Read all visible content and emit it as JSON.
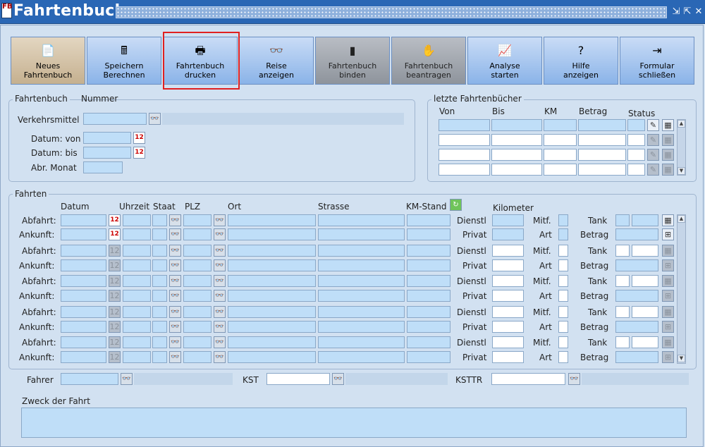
{
  "window": {
    "title": "Fahrtenbuch",
    "app_icon": "fahrtenbuch-app-icon"
  },
  "toolbar": [
    {
      "name": "new-logbook-button",
      "line1": "Neues",
      "line2": "Fahrtenbuch",
      "icon": "new-document-icon",
      "glyph": "📄",
      "state": "selected"
    },
    {
      "name": "save-calculate-button",
      "line1": "Speichern",
      "line2": "Berechnen",
      "icon": "save-calculator-icon",
      "glyph": "🖩",
      "state": "normal"
    },
    {
      "name": "print-logbook-button",
      "line1": "Fahrtenbuch",
      "line2": "drucken",
      "icon": "printer-icon",
      "glyph": "🖶",
      "state": "normal"
    },
    {
      "name": "show-trip-button",
      "line1": "Reise",
      "line2": "anzeigen",
      "icon": "binoculars-icon",
      "glyph": "👓",
      "state": "normal"
    },
    {
      "name": "bind-logbook-button",
      "line1": "Fahrtenbuch",
      "line2": "binden",
      "icon": "binder-icon",
      "glyph": "▮",
      "state": "disabled"
    },
    {
      "name": "request-logbook-button",
      "line1": "Fahrtenbuch",
      "line2": "beantragen",
      "icon": "request-person-icon",
      "glyph": "✋",
      "state": "disabled"
    },
    {
      "name": "start-analysis-button",
      "line1": "Analyse",
      "line2": "starten",
      "icon": "chart-presentation-icon",
      "glyph": "📈",
      "state": "normal"
    },
    {
      "name": "show-help-button",
      "line1": "Hilfe",
      "line2": "anzeigen",
      "icon": "help-icon",
      "glyph": "?",
      "state": "normal"
    },
    {
      "name": "close-form-button",
      "line1": "Formular",
      "line2": "schließen",
      "icon": "exit-door-icon",
      "glyph": "⇥",
      "state": "normal"
    }
  ],
  "logbook": {
    "legend": "Fahrtenbuch",
    "number_label": "Nummer",
    "vehicle_label": "Verkehrsmittel",
    "vehicle_value": "",
    "date_from_label": "Datum: von",
    "date_to_label": "Datum: bis",
    "month_label": "Abr. Monat"
  },
  "recent": {
    "legend": "letzte Fahrtenbücher",
    "columns": [
      "Von",
      "Bis",
      "KM",
      "Betrag",
      "Status"
    ],
    "row_count": 4
  },
  "trips": {
    "legend": "Fahrten",
    "columns": {
      "datum": "Datum",
      "uhrzeit": "Uhrzeit",
      "staat": "Staat",
      "plz": "PLZ",
      "ort": "Ort",
      "strasse": "Strasse",
      "km_stand": "KM-Stand",
      "kilometer": "Kilometer"
    },
    "departure_label": "Abfahrt:",
    "arrival_label": "Ankunft:",
    "dienstl_label": "Dienstl",
    "privat_label": "Privat",
    "mitf_label": "Mitf.",
    "art_label": "Art",
    "tank_label": "Tank",
    "betrag_label": "Betrag",
    "trip_count": 5
  },
  "footer": {
    "driver_label": "Fahrer",
    "kst_label": "KST",
    "ksttr_label": "KSTTR",
    "purpose_label": "Zweck der Fahrt",
    "purpose_value": ""
  },
  "colors": {
    "title_bar": "#2a67b5",
    "field": "#bfdef8",
    "highlight": "#e02020"
  }
}
